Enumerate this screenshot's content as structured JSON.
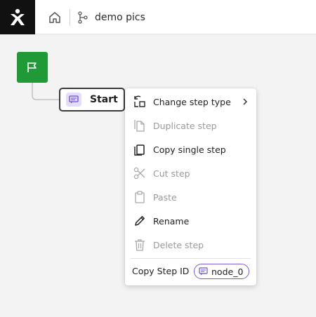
{
  "header": {
    "project_title": "demo pics"
  },
  "colors": {
    "flag_node": "#1f9a36",
    "accent_purple": "#7b5cd6",
    "disabled_text": "#9a9a9a"
  },
  "canvas": {
    "start_node": {
      "label": "Start",
      "icon": "message-icon"
    },
    "flag_node": {
      "icon": "flag-icon"
    }
  },
  "context_menu": {
    "items": [
      {
        "label": "Change step type",
        "icon": "change-type-icon",
        "enabled": true,
        "has_submenu": true
      },
      {
        "label": "Duplicate step",
        "icon": "duplicate-icon",
        "enabled": false
      },
      {
        "label": "Copy single step",
        "icon": "copy-icon",
        "enabled": true
      },
      {
        "label": "Cut step",
        "icon": "scissors-icon",
        "enabled": false
      },
      {
        "label": "Paste",
        "icon": "clipboard-icon",
        "enabled": false
      },
      {
        "label": "Rename",
        "icon": "pencil-icon",
        "enabled": true
      },
      {
        "label": "Delete step",
        "icon": "trash-icon",
        "enabled": false
      }
    ],
    "copy_id": {
      "label": "Copy Step ID",
      "node_id": "node_0"
    }
  }
}
